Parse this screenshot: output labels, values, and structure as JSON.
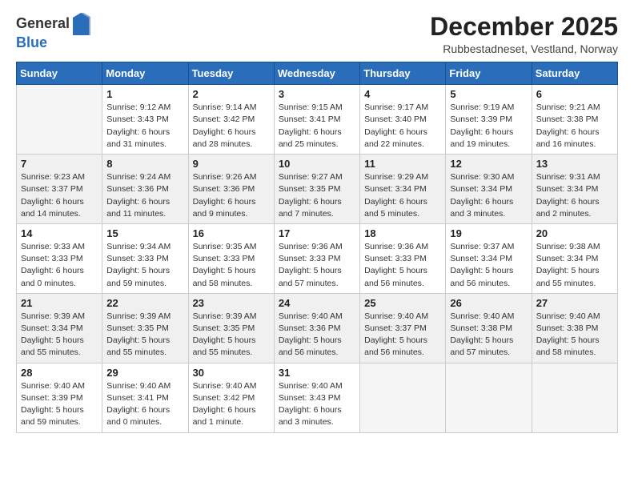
{
  "logo": {
    "general": "General",
    "blue": "Blue"
  },
  "title": "December 2025",
  "subtitle": "Rubbestadneset, Vestland, Norway",
  "days_of_week": [
    "Sunday",
    "Monday",
    "Tuesday",
    "Wednesday",
    "Thursday",
    "Friday",
    "Saturday"
  ],
  "weeks": [
    [
      {
        "day": "",
        "empty": true
      },
      {
        "day": "1",
        "sunrise": "9:12 AM",
        "sunset": "3:43 PM",
        "daylight": "6 hours and 31 minutes."
      },
      {
        "day": "2",
        "sunrise": "9:14 AM",
        "sunset": "3:42 PM",
        "daylight": "6 hours and 28 minutes."
      },
      {
        "day": "3",
        "sunrise": "9:15 AM",
        "sunset": "3:41 PM",
        "daylight": "6 hours and 25 minutes."
      },
      {
        "day": "4",
        "sunrise": "9:17 AM",
        "sunset": "3:40 PM",
        "daylight": "6 hours and 22 minutes."
      },
      {
        "day": "5",
        "sunrise": "9:19 AM",
        "sunset": "3:39 PM",
        "daylight": "6 hours and 19 minutes."
      },
      {
        "day": "6",
        "sunrise": "9:21 AM",
        "sunset": "3:38 PM",
        "daylight": "6 hours and 16 minutes."
      }
    ],
    [
      {
        "day": "7",
        "sunrise": "9:23 AM",
        "sunset": "3:37 PM",
        "daylight": "6 hours and 14 minutes."
      },
      {
        "day": "8",
        "sunrise": "9:24 AM",
        "sunset": "3:36 PM",
        "daylight": "6 hours and 11 minutes."
      },
      {
        "day": "9",
        "sunrise": "9:26 AM",
        "sunset": "3:36 PM",
        "daylight": "6 hours and 9 minutes."
      },
      {
        "day": "10",
        "sunrise": "9:27 AM",
        "sunset": "3:35 PM",
        "daylight": "6 hours and 7 minutes."
      },
      {
        "day": "11",
        "sunrise": "9:29 AM",
        "sunset": "3:34 PM",
        "daylight": "6 hours and 5 minutes."
      },
      {
        "day": "12",
        "sunrise": "9:30 AM",
        "sunset": "3:34 PM",
        "daylight": "6 hours and 3 minutes."
      },
      {
        "day": "13",
        "sunrise": "9:31 AM",
        "sunset": "3:34 PM",
        "daylight": "6 hours and 2 minutes."
      }
    ],
    [
      {
        "day": "14",
        "sunrise": "9:33 AM",
        "sunset": "3:33 PM",
        "daylight": "6 hours and 0 minutes."
      },
      {
        "day": "15",
        "sunrise": "9:34 AM",
        "sunset": "3:33 PM",
        "daylight": "5 hours and 59 minutes."
      },
      {
        "day": "16",
        "sunrise": "9:35 AM",
        "sunset": "3:33 PM",
        "daylight": "5 hours and 58 minutes."
      },
      {
        "day": "17",
        "sunrise": "9:36 AM",
        "sunset": "3:33 PM",
        "daylight": "5 hours and 57 minutes."
      },
      {
        "day": "18",
        "sunrise": "9:36 AM",
        "sunset": "3:33 PM",
        "daylight": "5 hours and 56 minutes."
      },
      {
        "day": "19",
        "sunrise": "9:37 AM",
        "sunset": "3:34 PM",
        "daylight": "5 hours and 56 minutes."
      },
      {
        "day": "20",
        "sunrise": "9:38 AM",
        "sunset": "3:34 PM",
        "daylight": "5 hours and 55 minutes."
      }
    ],
    [
      {
        "day": "21",
        "sunrise": "9:39 AM",
        "sunset": "3:34 PM",
        "daylight": "5 hours and 55 minutes."
      },
      {
        "day": "22",
        "sunrise": "9:39 AM",
        "sunset": "3:35 PM",
        "daylight": "5 hours and 55 minutes."
      },
      {
        "day": "23",
        "sunrise": "9:39 AM",
        "sunset": "3:35 PM",
        "daylight": "5 hours and 55 minutes."
      },
      {
        "day": "24",
        "sunrise": "9:40 AM",
        "sunset": "3:36 PM",
        "daylight": "5 hours and 56 minutes."
      },
      {
        "day": "25",
        "sunrise": "9:40 AM",
        "sunset": "3:37 PM",
        "daylight": "5 hours and 56 minutes."
      },
      {
        "day": "26",
        "sunrise": "9:40 AM",
        "sunset": "3:38 PM",
        "daylight": "5 hours and 57 minutes."
      },
      {
        "day": "27",
        "sunrise": "9:40 AM",
        "sunset": "3:38 PM",
        "daylight": "5 hours and 58 minutes."
      }
    ],
    [
      {
        "day": "28",
        "sunrise": "9:40 AM",
        "sunset": "3:39 PM",
        "daylight": "5 hours and 59 minutes."
      },
      {
        "day": "29",
        "sunrise": "9:40 AM",
        "sunset": "3:41 PM",
        "daylight": "6 hours and 0 minutes."
      },
      {
        "day": "30",
        "sunrise": "9:40 AM",
        "sunset": "3:42 PM",
        "daylight": "6 hours and 1 minute."
      },
      {
        "day": "31",
        "sunrise": "9:40 AM",
        "sunset": "3:43 PM",
        "daylight": "6 hours and 3 minutes."
      },
      {
        "day": "",
        "empty": true
      },
      {
        "day": "",
        "empty": true
      },
      {
        "day": "",
        "empty": true
      }
    ]
  ]
}
